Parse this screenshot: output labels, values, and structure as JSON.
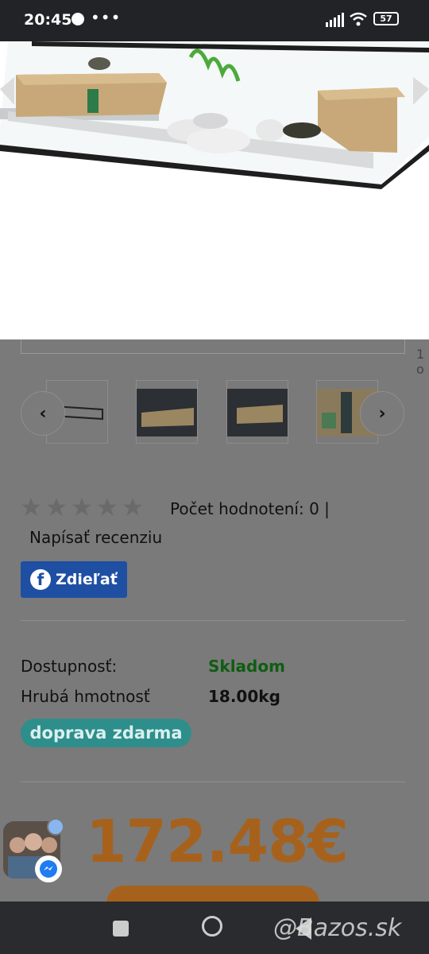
{
  "status_bar": {
    "time": "20:45",
    "battery": "57"
  },
  "gallery": {
    "counter_partial": "1 o"
  },
  "rating": {
    "stars_filled": 0,
    "stars_total": 5,
    "count_text": "Počet hodnotení: 0  |",
    "write_review": "Napísať recenziu"
  },
  "share": {
    "label": "Zdieľať",
    "fb_letter": "f"
  },
  "details": {
    "availability_label": "Dostupnosť:",
    "availability_value": "Skladom",
    "weight_label": "Hrubá hmotnosť",
    "weight_value": "18.00kg",
    "shipping_badge": "doprava zdarma"
  },
  "price": "172.48€",
  "watermark": "@Bazos.sk",
  "colors": {
    "availability": "#0f5d12",
    "price": "#a6621d",
    "share": "#1e4fa3",
    "badge": "#2e8e8b"
  }
}
